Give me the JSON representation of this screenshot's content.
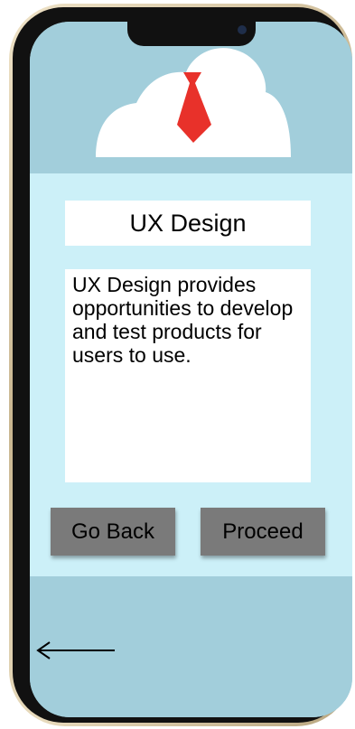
{
  "card": {
    "title": "UX Design",
    "description": "UX Design provides opportunities to develop and test products for users to use."
  },
  "actions": {
    "back_label": "Go Back",
    "proceed_label": "Proceed"
  },
  "icons": {
    "logo": "cloud-tie-icon",
    "nav_back": "left-arrow-icon"
  },
  "colors": {
    "header_bg": "#a2cedb",
    "panel_bg": "#ccf0f8",
    "button_bg": "#7a7a7a",
    "tie": "#e8312a"
  }
}
